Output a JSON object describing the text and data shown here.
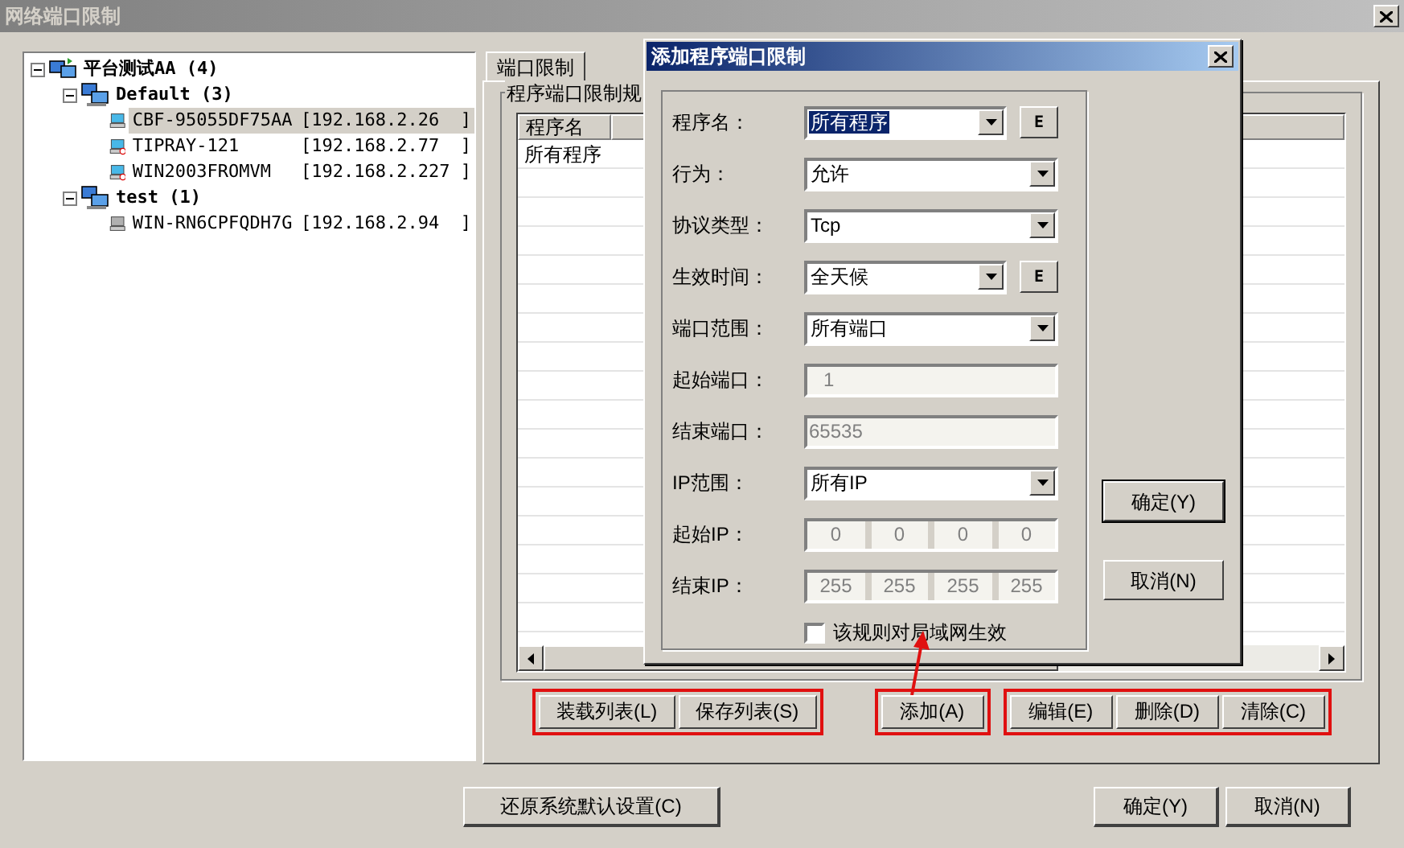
{
  "window": {
    "title": "网络端口限制"
  },
  "tree": [
    {
      "label": "平台测试AA (4)",
      "kind": "root",
      "expanded": true,
      "children": [
        {
          "label": "Default (3)",
          "kind": "group",
          "expanded": true,
          "children": [
            {
              "label": "CBF-95055DF75AA",
              "ip": "[192.168.2.26  ]",
              "kind": "computer",
              "selected": true
            },
            {
              "label": "TIPRAY-121",
              "ip": "[192.168.2.77  ]",
              "kind": "marked_computer",
              "selected": false
            },
            {
              "label": "WIN2003FROMVM",
              "ip": "[192.168.2.227 ]",
              "kind": "marked_computer",
              "selected": false
            }
          ]
        },
        {
          "label": "test (1)",
          "kind": "group",
          "expanded": true,
          "children": [
            {
              "label": "WIN-RN6CPFQDH7G",
              "ip": "[192.168.2.94  ]",
              "kind": "offline_computer",
              "selected": false
            }
          ]
        }
      ]
    }
  ],
  "tabs": [
    {
      "label": "端口限制",
      "selected": true
    }
  ],
  "group": {
    "title": "程序端口限制规"
  },
  "list": {
    "columns": [
      "程序名"
    ],
    "rows": [
      [
        "所有程序"
      ]
    ]
  },
  "button_groups": [
    {
      "highlighted": true,
      "buttons": [
        "装载列表(L)",
        "保存列表(S)"
      ]
    },
    {
      "highlighted": true,
      "buttons": [
        "添加(A)"
      ]
    },
    {
      "highlighted": true,
      "buttons": [
        "编辑(E)",
        "删除(D)",
        "清除(C)"
      ]
    }
  ],
  "footer": {
    "restore_button": "还原系统默认设置(C)",
    "buttons": [
      "确定(Y)",
      "取消(N)"
    ]
  },
  "dialog": {
    "title": "添加程序端口限制",
    "fields": [
      {
        "label": "程序名：",
        "kind": "combo",
        "value": "所有程序",
        "selected_text": true,
        "extra_button": "E"
      },
      {
        "label": "行为：",
        "kind": "combo",
        "value": "允许"
      },
      {
        "label": "协议类型：",
        "kind": "combo",
        "value": "Tcp"
      },
      {
        "label": "生效时间：",
        "kind": "combo",
        "value": "全天候",
        "extra_button": "E"
      },
      {
        "label": "端口范围：",
        "kind": "combo",
        "value": "所有端口"
      },
      {
        "label": "起始端口：",
        "kind": "text",
        "value": "1",
        "disabled": true
      },
      {
        "label": "结束端口：",
        "kind": "text",
        "value": "65535",
        "disabled": true
      },
      {
        "label": "IP范围：",
        "kind": "combo",
        "value": "所有IP"
      },
      {
        "label": "起始IP：",
        "kind": "ip",
        "octets": [
          "0",
          "0",
          "0",
          "0"
        ],
        "disabled": true
      },
      {
        "label": "结束IP：",
        "kind": "ip",
        "octets": [
          "255",
          "255",
          "255",
          "255"
        ],
        "disabled": true
      }
    ],
    "checkbox": {
      "label": "该规则对局域网生效",
      "checked": false
    },
    "buttons": [
      "确定(Y)",
      "取消(N)"
    ]
  }
}
